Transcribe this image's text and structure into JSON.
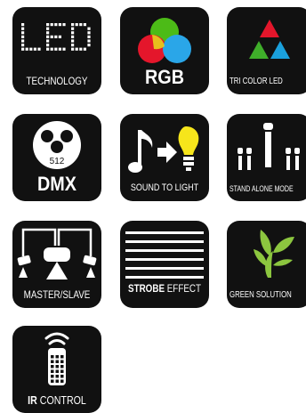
{
  "tiles": {
    "led": {
      "label": "TECHNOLOGY",
      "mark": "LED"
    },
    "rgb": {
      "label": "RGB",
      "colors": [
        "#e4162b",
        "#4cbb17",
        "#2aa6e8"
      ]
    },
    "tri": {
      "label": "TRI COLOR LED",
      "colors": [
        "#e4162b",
        "#3fae2a",
        "#1aa0dc"
      ]
    },
    "dmx": {
      "label": "DMX",
      "number": "512"
    },
    "sound": {
      "label": "SOUND TO LIGHT",
      "bulb_color": "#f6e51b"
    },
    "stand": {
      "label": "STAND ALONE MODE"
    },
    "master": {
      "label": "MASTER/SLAVE"
    },
    "strobe": {
      "label_bold": "STROBE",
      "label_rest": " EFFECT"
    },
    "green": {
      "label": "GREEN SOLUTION",
      "leaf_color": "#8cc63f"
    },
    "ir": {
      "label_bold": "IR",
      "label_rest": " CONTROL"
    }
  },
  "tile_bg": "#111111"
}
